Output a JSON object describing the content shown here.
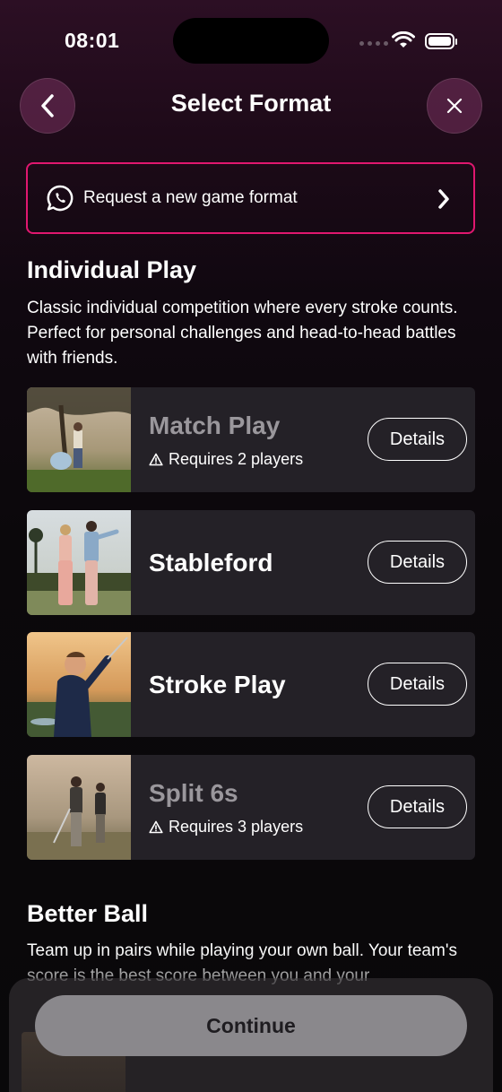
{
  "status_bar": {
    "time": "08:01"
  },
  "header": {
    "title": "Select Format"
  },
  "request_banner": {
    "label": "Request a new game format"
  },
  "sections": [
    {
      "title": "Individual Play",
      "description": "Classic individual competition where every stroke counts. Perfect for personal challenges and head-to-head battles with friends.",
      "formats": [
        {
          "name": "Match Play",
          "requirement": "Requires 2 players",
          "available": false,
          "details_label": "Details"
        },
        {
          "name": "Stableford",
          "requirement": "",
          "available": true,
          "details_label": "Details"
        },
        {
          "name": "Stroke Play",
          "requirement": "",
          "available": true,
          "details_label": "Details"
        },
        {
          "name": "Split 6s",
          "requirement": "Requires 3 players",
          "available": false,
          "details_label": "Details"
        }
      ]
    },
    {
      "title": "Better Ball",
      "description": "Team up in pairs while playing your own ball. Your team's score is the best score between you and your"
    }
  ],
  "footer": {
    "continue_label": "Continue"
  },
  "colors": {
    "accent": "#e0176f",
    "card_bg": "#242127",
    "button_disabled": "#8a888c"
  }
}
